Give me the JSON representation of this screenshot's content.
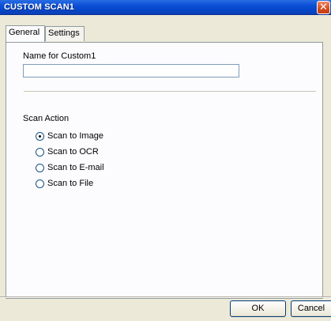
{
  "window": {
    "title": "CUSTOM SCAN1",
    "close_symbol": "✕"
  },
  "tabs": [
    {
      "label": "General",
      "active": true
    },
    {
      "label": "Settings",
      "active": false
    }
  ],
  "general": {
    "name_label": "Name for Custom1",
    "name_value": "",
    "scan_action_label": "Scan Action",
    "scan_actions": [
      {
        "label": "Scan to Image",
        "selected": true
      },
      {
        "label": "Scan to OCR",
        "selected": false
      },
      {
        "label": "Scan to E-mail",
        "selected": false
      },
      {
        "label": "Scan to File",
        "selected": false
      }
    ]
  },
  "buttons": {
    "ok": "OK",
    "cancel": "Cancel"
  },
  "colors": {
    "titlebar": "#0a4fd6",
    "close": "#d44a1c",
    "dialog_bg": "#ece9d8",
    "panel_bg": "#fcfcfe"
  }
}
